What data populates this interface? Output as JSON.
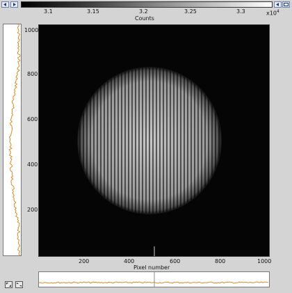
{
  "colorbar": {
    "ticks": [
      "3.1",
      "3.15",
      "3.2",
      "3.25",
      "3.3"
    ],
    "exponent": "x10",
    "exponent_power": "4",
    "title": "Counts"
  },
  "image": {
    "y_ticks": [
      "1000",
      "800",
      "600",
      "400",
      "200"
    ],
    "x_ticks": [
      "200",
      "400",
      "600",
      "800",
      "1000"
    ],
    "xlabel": "Pixel number"
  },
  "icons": {
    "toolbar": [
      "nav-left-icon",
      "play-icon",
      "nav-right-icon",
      "expand-icon"
    ],
    "bottom_left": [
      "zoom-icon",
      "fit-icon"
    ]
  },
  "colors": {
    "profile_line": "#e08a1e",
    "cursor_line": "#cccccc",
    "image_bg": "#000000"
  }
}
